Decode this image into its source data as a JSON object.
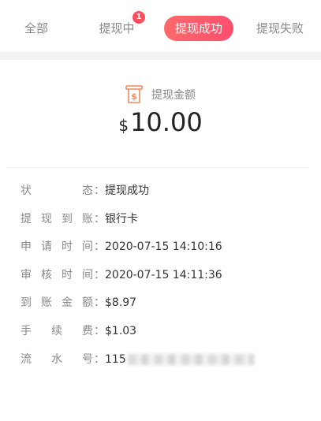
{
  "tabs": [
    {
      "label": "全部"
    },
    {
      "label": "提现中",
      "badge": "1"
    },
    {
      "label": "提现成功",
      "active": true
    },
    {
      "label": "提现失败"
    }
  ],
  "amount": {
    "label": "提现金额",
    "currency": "$",
    "value": "10.00"
  },
  "details": [
    {
      "key": [
        "状",
        "态"
      ],
      "value": "提现成功"
    },
    {
      "key": [
        "提",
        "现",
        "到",
        "账"
      ],
      "value": "银行卡"
    },
    {
      "key": [
        "申",
        "请",
        "时",
        "间"
      ],
      "value": "2020-07-15 14:10:16"
    },
    {
      "key": [
        "审",
        "核",
        "时",
        "间"
      ],
      "value": "2020-07-15 14:11:36"
    },
    {
      "key": [
        "到",
        "账",
        "金",
        "额"
      ],
      "value": "$8.97"
    },
    {
      "key": [
        "手",
        "续",
        "费"
      ],
      "value": "$1.03"
    },
    {
      "key": [
        "流",
        "水",
        "号"
      ],
      "value": "115"
    }
  ],
  "colors": {
    "accent_start": "#ff6a6a",
    "accent_end": "#ff4e6e",
    "icon": "#f08a5d"
  }
}
